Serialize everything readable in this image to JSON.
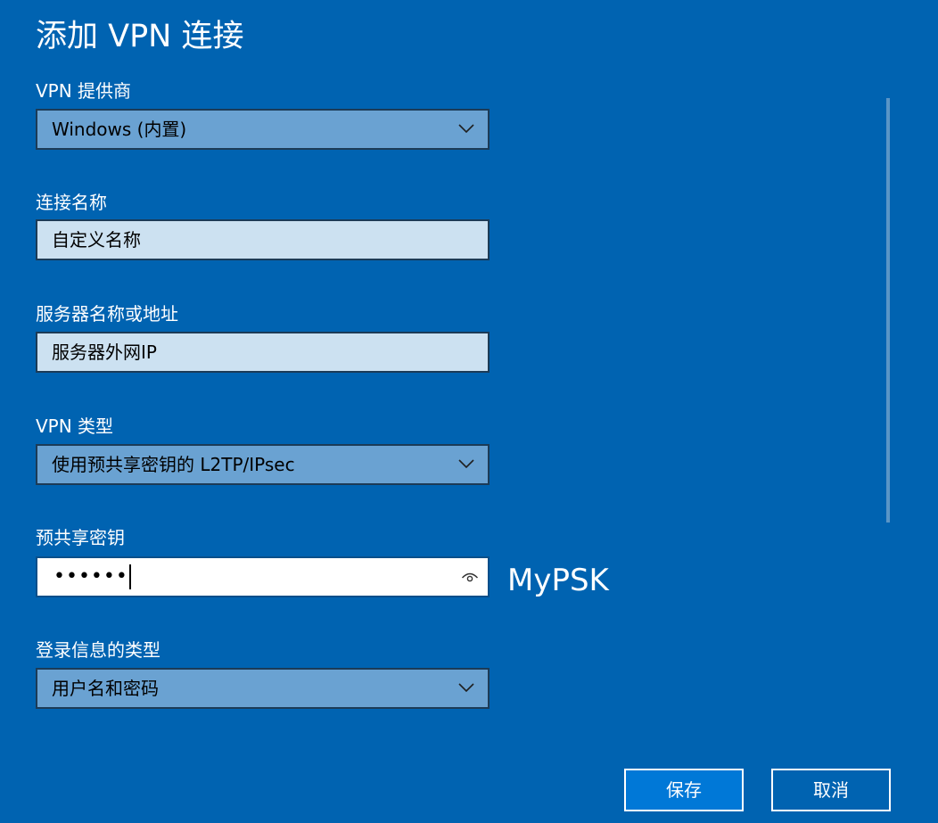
{
  "window": {
    "title": "添加 VPN 连接"
  },
  "colors": {
    "background": "#0063b1",
    "select_fill": "#6aa2d2",
    "input_fill": "#cce1f1",
    "primary_button": "#0078d7"
  },
  "form": {
    "vpn_provider": {
      "label": "VPN 提供商",
      "value": "Windows (内置)",
      "icon": "chevron-down-icon"
    },
    "connection_name": {
      "label": "连接名称",
      "value": "自定义名称"
    },
    "server_address": {
      "label": "服务器名称或地址",
      "value": "服务器外网IP"
    },
    "vpn_type": {
      "label": "VPN 类型",
      "value": "使用预共享密钥的 L2TP/IPsec",
      "icon": "chevron-down-icon"
    },
    "preshared_key": {
      "label": "预共享密钥",
      "masked_value": "••••••",
      "icon": "eye-icon",
      "annotation": "MyPSK"
    },
    "signin_type": {
      "label": "登录信息的类型",
      "value": "用户名和密码",
      "icon": "chevron-down-icon"
    }
  },
  "buttons": {
    "save": "保存",
    "cancel": "取消"
  }
}
